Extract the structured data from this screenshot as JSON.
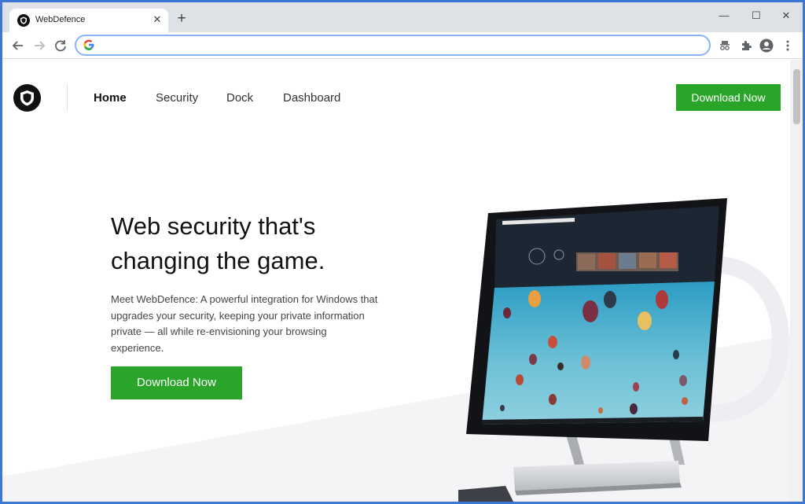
{
  "browser": {
    "tab_title": "WebDefence",
    "address_value": "",
    "window_controls": {
      "minimize": "—",
      "maximize": "☐",
      "close": "✕"
    }
  },
  "site": {
    "nav": [
      {
        "label": "Home",
        "active": true
      },
      {
        "label": "Security",
        "active": false
      },
      {
        "label": "Dock",
        "active": false
      },
      {
        "label": "Dashboard",
        "active": false
      }
    ],
    "header_cta": "Download Now"
  },
  "hero": {
    "title_line1": "Web security that's",
    "title_line2": "changing the game.",
    "description": "Meet WebDefence: A powerful integration for Windows that upgrades your security, keeping your private information private — all while re-envisioning your browsing experience.",
    "cta": "Download Now"
  },
  "colors": {
    "accent_green": "#2aa52a",
    "window_border": "#3a78d4",
    "tab_strip": "#dee1e6"
  }
}
